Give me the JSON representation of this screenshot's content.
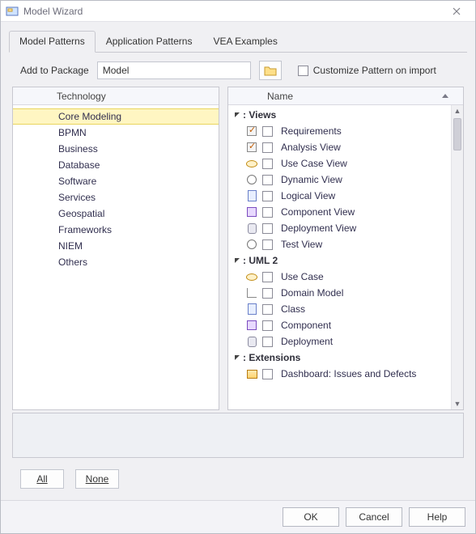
{
  "window": {
    "title": "Model Wizard"
  },
  "tabs": {
    "model_patterns": "Model Patterns",
    "application_patterns": "Application Patterns",
    "vea_examples": "VEA Examples"
  },
  "toolbar": {
    "add_to_package_label": "Add to Package",
    "package_value": "Model",
    "customize_label": "Customize Pattern on import"
  },
  "left": {
    "header": "Technology",
    "items": [
      "Core Modeling",
      "BPMN",
      "Business",
      "Database",
      "Software",
      "Services",
      "Geospatial",
      "Frameworks",
      "NIEM",
      "Others"
    ],
    "selected_index": 0
  },
  "right": {
    "header": "Name",
    "groups": [
      {
        "label": ": Views",
        "items": [
          {
            "icon": "check",
            "label": "Requirements"
          },
          {
            "icon": "check",
            "label": "Analysis View"
          },
          {
            "icon": "ellipse",
            "label": "Use Case View"
          },
          {
            "icon": "gear",
            "label": "Dynamic View"
          },
          {
            "icon": "doc",
            "label": "Logical View"
          },
          {
            "icon": "box",
            "label": "Component View"
          },
          {
            "icon": "db",
            "label": "Deployment View"
          },
          {
            "icon": "gear",
            "label": "Test View"
          }
        ]
      },
      {
        "label": ": UML 2",
        "items": [
          {
            "icon": "ellipse",
            "label": "Use Case"
          },
          {
            "icon": "tree",
            "label": "Domain Model"
          },
          {
            "icon": "doc",
            "label": "Class"
          },
          {
            "icon": "box",
            "label": "Component"
          },
          {
            "icon": "db",
            "label": "Deployment"
          }
        ]
      },
      {
        "label": ": Extensions",
        "items": [
          {
            "icon": "dash",
            "label": "Dashboard: Issues and Defects"
          }
        ]
      }
    ]
  },
  "bottom": {
    "all": "All",
    "none": "None"
  },
  "dialog": {
    "ok": "OK",
    "cancel": "Cancel",
    "help": "Help"
  }
}
